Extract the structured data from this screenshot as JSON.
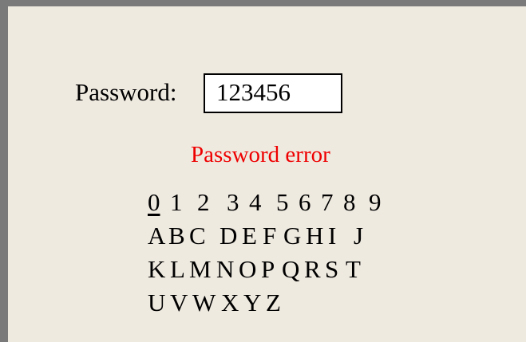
{
  "password": {
    "label": "Password:",
    "value": "123456"
  },
  "status": {
    "message": "Password error",
    "color": "#ee0000"
  },
  "keyboard": {
    "rows": [
      [
        "0",
        "1",
        "2",
        "3",
        "4",
        "5",
        "6",
        "7",
        "8",
        "9"
      ],
      [
        "A",
        "B",
        "C",
        "D",
        "E",
        "F",
        "G",
        "H",
        "I",
        "J"
      ],
      [
        "K",
        "L",
        "M",
        "N",
        "O",
        "P",
        "Q",
        "R",
        "S",
        "T"
      ],
      [
        "U",
        "V",
        "W",
        "X",
        "Y",
        "Z"
      ]
    ],
    "selected_key": "0"
  }
}
